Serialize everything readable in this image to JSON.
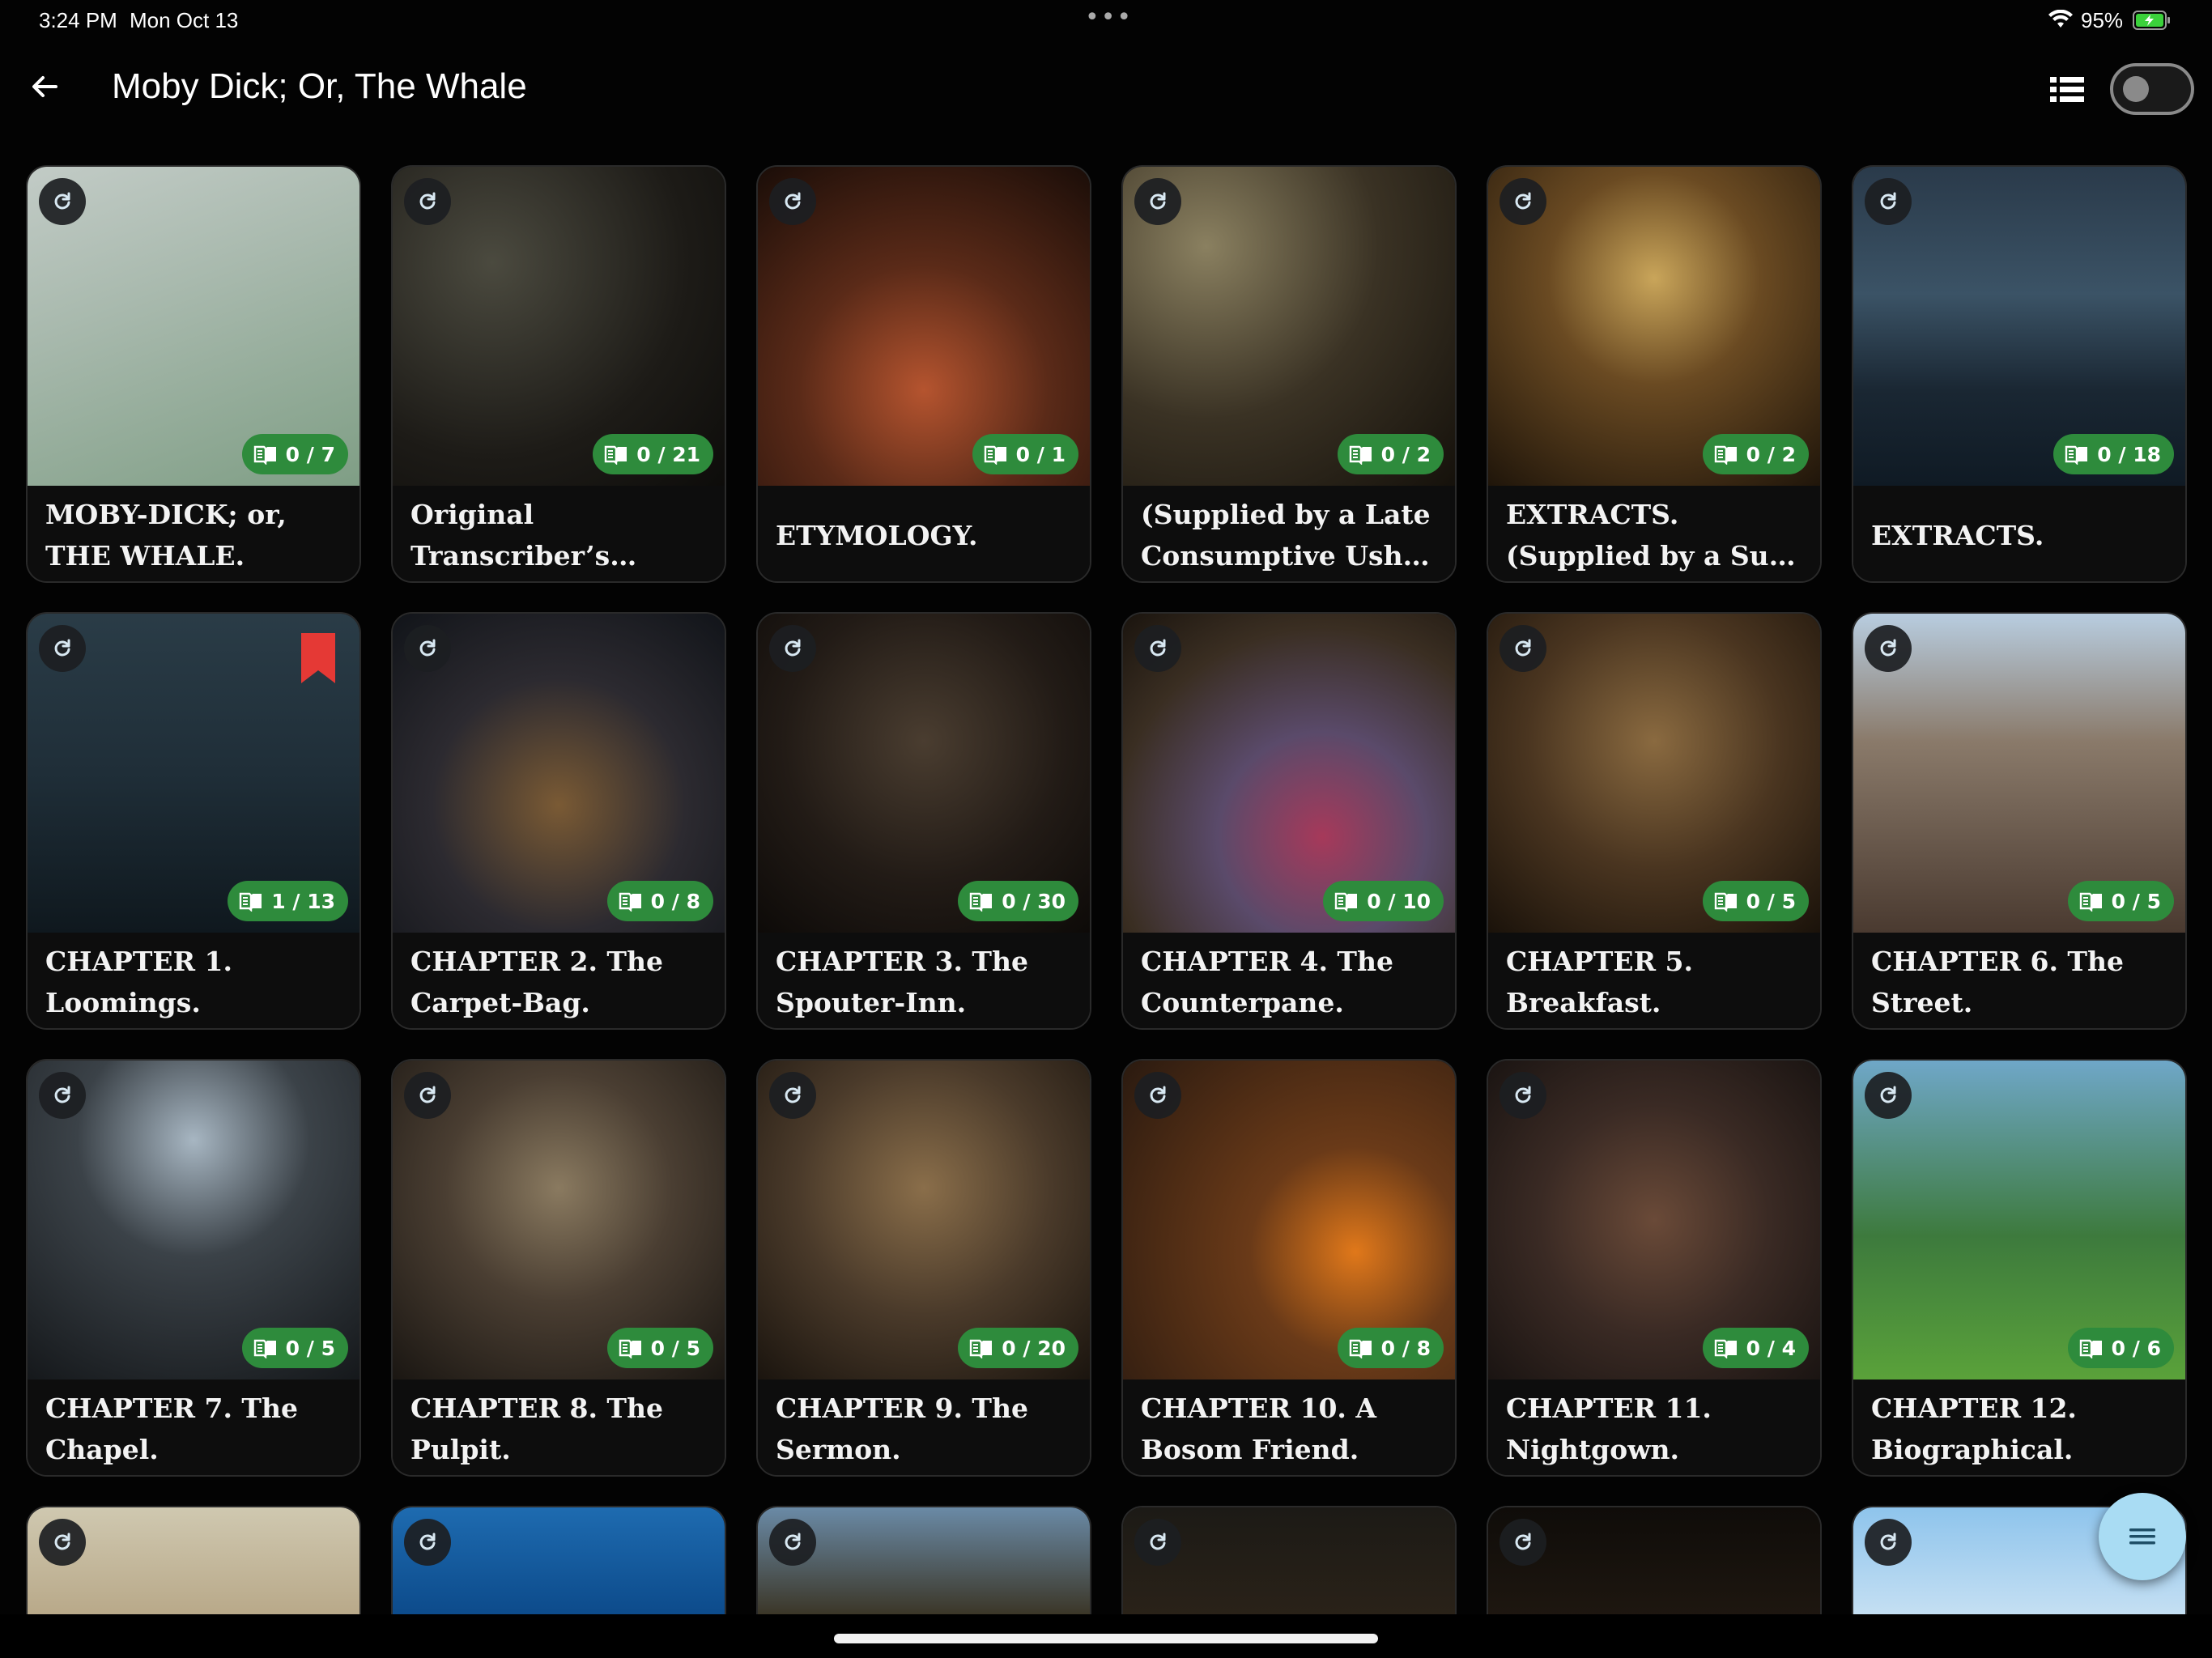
{
  "status": {
    "time": "3:24 PM",
    "date": "Mon Oct 13",
    "battery": "95%",
    "multitask": "•••"
  },
  "app_bar": {
    "title": "Moby Dick; Or, The Whale"
  },
  "icons": {
    "back": "arrow-left-icon",
    "list_view": "list-view-icon",
    "refresh": "refresh-icon",
    "progress": "book-icon",
    "bookmark": "bookmark-icon",
    "fab": "menu-icon"
  },
  "colors": {
    "badge_green": "#2e8b3c",
    "bookmark_red": "#e53935",
    "fab_blue": "#a9dcf3"
  },
  "toggle": {
    "on": false
  },
  "chapters": [
    {
      "title": "MOBY-DICK; or, THE WHALE.",
      "progress": "0 / 7"
    },
    {
      "title": "Original Transcriber’s Notes:",
      "progress": "0 / 21"
    },
    {
      "title": "ETYMOLOGY.",
      "progress": "0 / 1"
    },
    {
      "title": "(Supplied by a Late Consumptive Usher ...",
      "progress": "0 / 2"
    },
    {
      "title": "EXTRACTS. (Supplied by a Sub-Sub-Librar...",
      "progress": "0 / 2"
    },
    {
      "title": "EXTRACTS.",
      "progress": "0 / 18"
    },
    {
      "title": "CHAPTER 1. Loomings.",
      "progress": "1 / 13",
      "bookmarked": true
    },
    {
      "title": "CHAPTER 2. The Carpet-Bag.",
      "progress": "0 / 8"
    },
    {
      "title": "CHAPTER 3. The Spouter-Inn.",
      "progress": "0 / 30"
    },
    {
      "title": "CHAPTER 4. The Counterpane.",
      "progress": "0 / 10"
    },
    {
      "title": "CHAPTER 5. Breakfast.",
      "progress": "0 / 5"
    },
    {
      "title": "CHAPTER 6. The Street.",
      "progress": "0 / 5"
    },
    {
      "title": "CHAPTER 7. The Chapel.",
      "progress": "0 / 5"
    },
    {
      "title": "CHAPTER 8. The Pulpit.",
      "progress": "0 / 5"
    },
    {
      "title": "CHAPTER 9. The Sermon.",
      "progress": "0 / 20"
    },
    {
      "title": "CHAPTER 10. A Bosom Friend.",
      "progress": "0 / 8"
    },
    {
      "title": "CHAPTER 11. Nightgown.",
      "progress": "0 / 4"
    },
    {
      "title": "CHAPTER 12. Biographical.",
      "progress": "0 / 6"
    }
  ]
}
